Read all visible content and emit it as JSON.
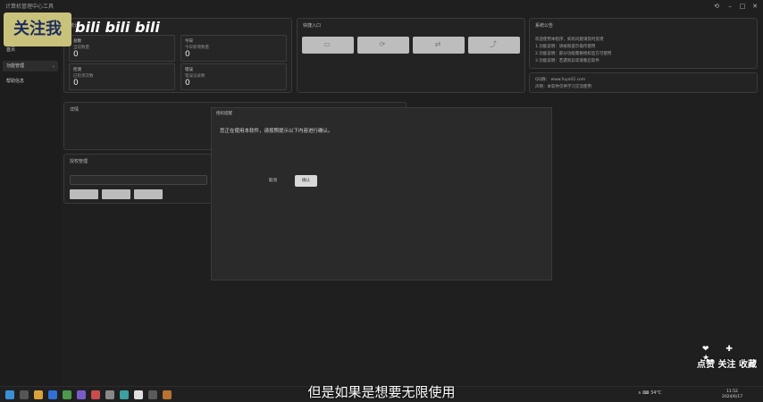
{
  "app": {
    "title": "计算机管理中心工具",
    "window_controls": [
      "⟲",
      "–",
      "□",
      "✕"
    ]
  },
  "sidebar": {
    "items": [
      {
        "label": "首页",
        "active": false
      },
      {
        "label": "功能管理",
        "active": true,
        "chevron": "⌄"
      },
      {
        "label": "帮助信息",
        "active": false
      }
    ]
  },
  "stats_card": {
    "title": "统计",
    "stats": [
      {
        "label": "总数",
        "sub": "当前数量",
        "value": "0"
      },
      {
        "label": "今日",
        "sub": "今日新增数量",
        "value": "0"
      },
      {
        "label": "检测",
        "sub": "已检测次数",
        "value": "0"
      },
      {
        "label": "错误",
        "sub": "错误记录数",
        "value": "0"
      }
    ]
  },
  "quick_card": {
    "title": "快捷入口",
    "buttons": [
      {
        "icon": "folder-icon",
        "glyph": "▭"
      },
      {
        "icon": "refresh-icon",
        "glyph": "⟳"
      },
      {
        "icon": "sync-icon",
        "glyph": "⇄"
      },
      {
        "icon": "link-icon",
        "glyph": "⤴"
      }
    ]
  },
  "notice_card": {
    "title": "系统公告",
    "lines": [
      "欢迎使用本程序，如有问题请及时反馈",
      "1.功能说明：请按照提示操作使用",
      "2.功能说明：部分功能需要授权后方可使用",
      "3.功能说明：若遇到异常请重启软件"
    ]
  },
  "contact_card": {
    "line1": "QQ群：  www.fuyo02.com",
    "line2": "声明：本软件仅供学习交流使用"
  },
  "info_card": {
    "title": "详情"
  },
  "input_card": {
    "title": "授权管理",
    "buttons": [
      "",
      "",
      ""
    ]
  },
  "modal": {
    "title": "授权提醒",
    "message": "您正在使用本软件，请按照提示以下内容进行确认。",
    "cancel_label": "取消",
    "ok_label": "确认"
  },
  "overlay": {
    "follow": "关注我",
    "bili": "bili bili bili",
    "subtitle": "但是如果是想要无限使用",
    "interact_icons": "❤ ✚ ★",
    "interact_words": "点赞 关注 收藏"
  },
  "taskbar": {
    "tray": "∧  ⌨  34°C",
    "time": "11:52",
    "date": "2024/6/17"
  }
}
